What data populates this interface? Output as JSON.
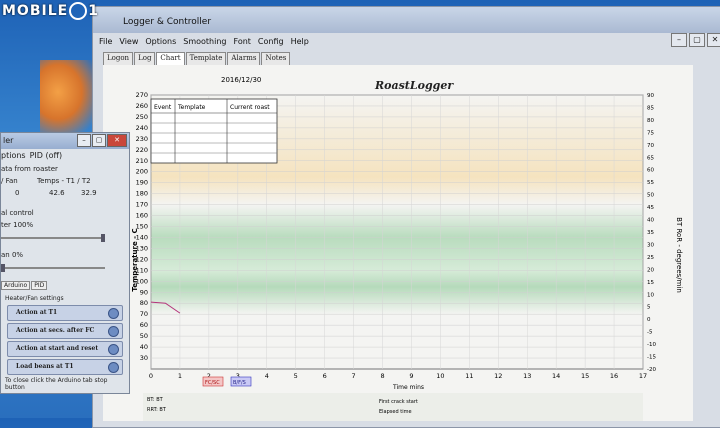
{
  "watermark": {
    "text_left": "MOBILE",
    "text_right": "1"
  },
  "main_window": {
    "title": "Logger & Controller",
    "controls": [
      "–",
      "▢",
      "✕"
    ],
    "menu": [
      "File",
      "View",
      "Options",
      "Smoothing",
      "Font",
      "Config",
      "Help"
    ],
    "tabs": [
      "Logon",
      "Log",
      "Chart",
      "Template",
      "Alarms",
      "Notes"
    ],
    "active_tab": "Chart"
  },
  "chart": {
    "date": "2016/12/30",
    "logo": "RoastLogger",
    "left_axis_label": "Temperature - C",
    "right_axis_label": "BT RoR - degrees/min",
    "x_axis_label": "Time mins",
    "table_headers": [
      "Event",
      "Template",
      "Current roast"
    ],
    "buttons": [
      "FC/SC",
      "B/F/S"
    ],
    "status_lines": [
      "BT: BT",
      "RRT: BT",
      "First crack start",
      "Elapsed time"
    ],
    "colors": {
      "green_band": "#a8d5ae",
      "orange_band": "#f3d8a0",
      "plot_bg": "#f4f4f2"
    }
  },
  "chart_data": {
    "type": "line",
    "title": "",
    "xlabel": "Time mins",
    "ylabel": "Temperature - C",
    "y2label": "BT RoR - degrees/min",
    "xlim": [
      0,
      17
    ],
    "ylim": [
      20,
      270
    ],
    "y2lim": [
      -20,
      90
    ],
    "x_ticks": [
      0,
      1,
      2,
      3,
      4,
      5,
      6,
      7,
      8,
      9,
      10,
      11,
      12,
      13,
      14,
      15,
      16,
      17
    ],
    "y_ticks": [
      30,
      40,
      50,
      60,
      70,
      80,
      90,
      100,
      110,
      120,
      130,
      140,
      150,
      160,
      170,
      180,
      190,
      200,
      210,
      220,
      230,
      240,
      250,
      260,
      270
    ],
    "y2_ticks": [
      -20,
      -15,
      -10,
      -5,
      0,
      5,
      10,
      15,
      20,
      25,
      30,
      35,
      40,
      45,
      50,
      55,
      60,
      65,
      70,
      75,
      80,
      85,
      90
    ],
    "grid": true,
    "series": [
      {
        "x": [
          0,
          0.5,
          1.0
        ],
        "values": [
          81,
          80,
          71
        ]
      }
    ]
  },
  "pid_window": {
    "title": "ler",
    "menu": [
      "ptions",
      "PID (off)"
    ],
    "lines": [
      "ata from roaster",
      "/ Fan",
      "Temps - T1 / T2",
      "0",
      "42.6",
      "32.9",
      "al control",
      "ter 100%",
      "an 0%"
    ],
    "tabs": [
      "Arduino",
      "PID"
    ],
    "settings_title": "Heater/Fan settings",
    "rows": [
      "Action at T1",
      "Action at secs. after FC",
      "Action at start and reset",
      "Load beans at T1"
    ],
    "footer": "To close click the Arduino tab stop button"
  }
}
